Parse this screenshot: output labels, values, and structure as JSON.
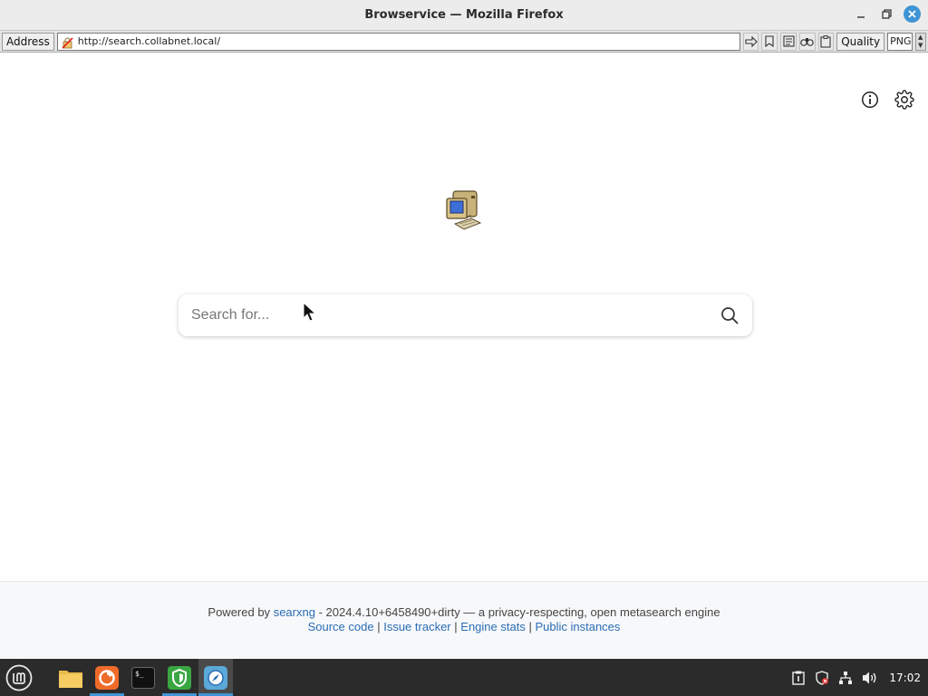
{
  "window": {
    "title": "Browservice — Mozilla Firefox",
    "controls": [
      "minimize-icon",
      "maximize-icon",
      "close-icon"
    ]
  },
  "toolbar": {
    "address_label": "Address",
    "url": "http://search.collabnet.local/",
    "buttons": [
      "go-icon",
      "bookmark-icon",
      "reader-icon",
      "find-icon",
      "clipboard-icon"
    ],
    "quality_label": "Quality",
    "quality_value": "PNG"
  },
  "page": {
    "top_icons": [
      "info-icon",
      "gear-icon"
    ],
    "logo": "computer-logo-icon",
    "search": {
      "placeholder": "Search for...",
      "value": ""
    },
    "footer": {
      "powered_by": "Powered by",
      "engine_name": "searxng",
      "version_text": "- 2024.4.10+6458490+dirty — a privacy-respecting, open metasearch engine",
      "links": [
        "Source code",
        "Issue tracker",
        "Engine stats",
        "Public instances"
      ],
      "separator": "|"
    }
  },
  "taskbar": {
    "menu_icon": "mint-menu-icon",
    "apps": [
      {
        "name": "files-icon",
        "active": false
      },
      {
        "name": "firefox-icon",
        "active": true
      },
      {
        "name": "terminal-icon",
        "active": false
      },
      {
        "name": "shield-app-icon",
        "active": true
      },
      {
        "name": "browser-app-icon",
        "active": true
      }
    ],
    "tray": [
      "clipboard-tray-icon",
      "shield-tray-icon",
      "network-icon",
      "volume-icon"
    ],
    "clock": "17:02"
  },
  "colors": {
    "accent": "#3f94d6",
    "link": "#2a6db5",
    "taskbar": "#2b2b2b"
  }
}
